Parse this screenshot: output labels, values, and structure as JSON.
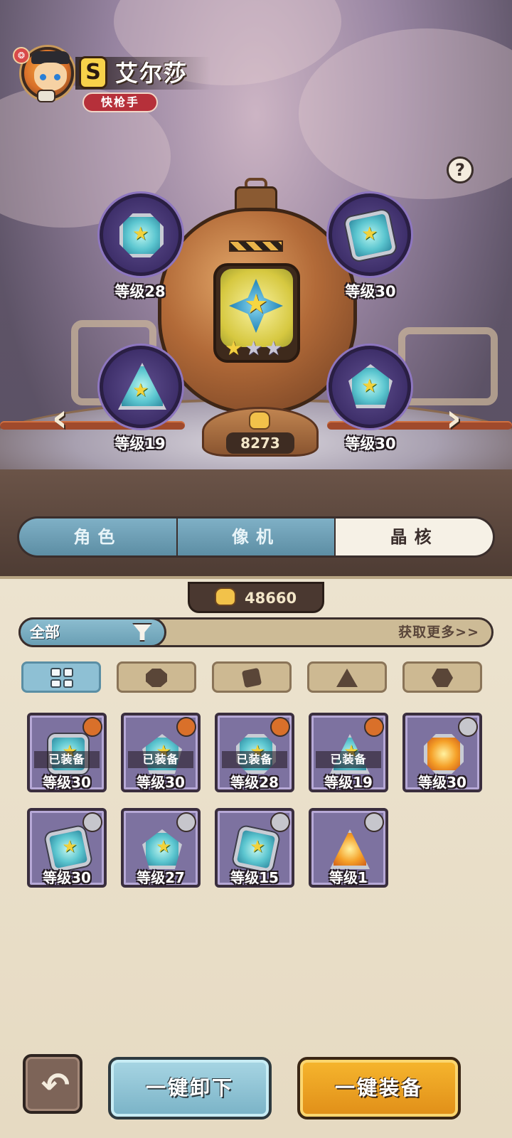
{
  "character": {
    "rank": "S",
    "name": "艾尔莎",
    "class": "快枪手"
  },
  "help": {
    "label": "?"
  },
  "machine": {
    "power": "8273",
    "stars_filled": 1,
    "stars_total": 3
  },
  "slots": [
    {
      "level": "等级28",
      "shape": "octagon"
    },
    {
      "level": "等级30",
      "shape": "square"
    },
    {
      "level": "等级19",
      "shape": "triangle"
    },
    {
      "level": "等级30",
      "shape": "pentagon"
    }
  ],
  "nav": {
    "prev": "‹",
    "next": "›"
  },
  "tabs": [
    {
      "label": "角色",
      "active": false
    },
    {
      "label": "像机",
      "active": false
    },
    {
      "label": "晶核",
      "active": true
    }
  ],
  "currency": {
    "value": "48660"
  },
  "filter": {
    "label": "全部",
    "get_more": "获取更多>>"
  },
  "shape_filters": [
    {
      "name": "all",
      "icon": "grid-icon",
      "active": true
    },
    {
      "name": "octagon",
      "icon": "octagon-icon",
      "active": false
    },
    {
      "name": "square",
      "icon": "square-icon",
      "active": false
    },
    {
      "name": "triangle",
      "icon": "triangle-icon",
      "active": false
    },
    {
      "name": "pentagon",
      "icon": "pentagon-icon",
      "active": false
    }
  ],
  "inventory": [
    {
      "level": "等级30",
      "equipped": "已装备",
      "gem": "cyan"
    },
    {
      "level": "等级30",
      "equipped": "已装备",
      "gem": "cyan"
    },
    {
      "level": "等级28",
      "equipped": "已装备",
      "gem": "cyan"
    },
    {
      "level": "等级19",
      "equipped": "已装备",
      "gem": "cyan"
    },
    {
      "level": "等级30",
      "equipped": "",
      "gem": "orange"
    },
    {
      "level": "等级30",
      "equipped": "",
      "gem": "cyan"
    },
    {
      "level": "等级27",
      "equipped": "",
      "gem": "cyan"
    },
    {
      "level": "等级15",
      "equipped": "",
      "gem": "cyan"
    },
    {
      "level": "等级1",
      "equipped": "",
      "gem": "orange"
    }
  ],
  "buttons": {
    "back": "↶",
    "unequip_all": "一键卸下",
    "equip_all": "一键装备"
  }
}
